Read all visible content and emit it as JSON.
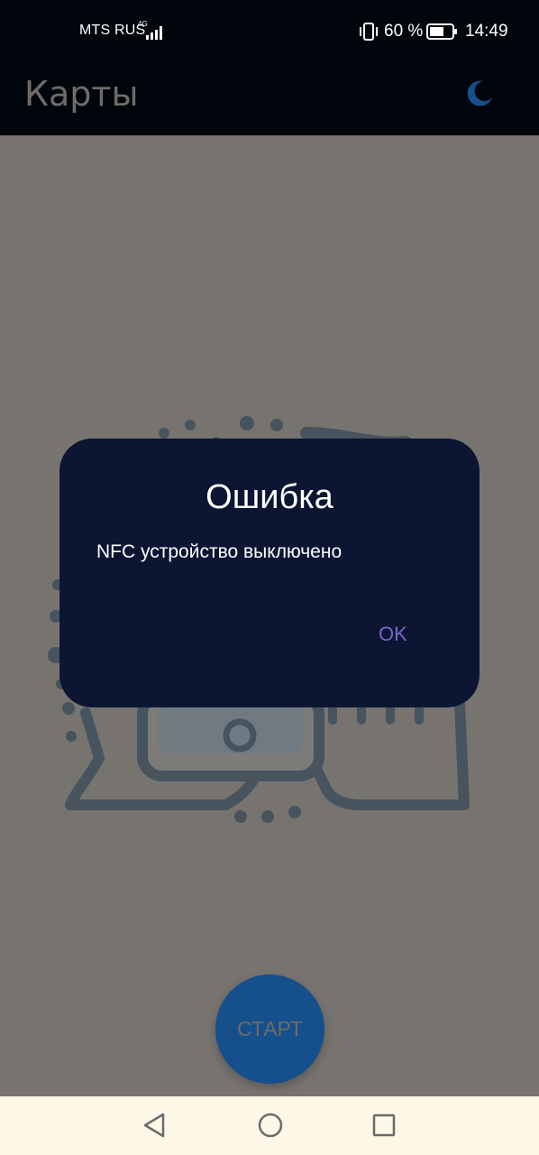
{
  "status_bar": {
    "carrier": "MTS RUS",
    "network_type": "4G",
    "battery_percent": "60 %",
    "time": "14:49"
  },
  "app_bar": {
    "title": "Карты",
    "theme_icon": "moon-icon"
  },
  "dialog": {
    "title": "Ошибка",
    "message": "NFC устройство выключено",
    "ok_label": "OK"
  },
  "start_button": {
    "label": "СТАРТ"
  },
  "colors": {
    "app_bar_bg": "#01050c",
    "scrim_bg": "#777470",
    "dialog_bg": "#0c1633",
    "accent_blue": "#154f8c",
    "ok_purple": "#7b63c9",
    "nav_bar_bg": "#fdf7e8"
  }
}
